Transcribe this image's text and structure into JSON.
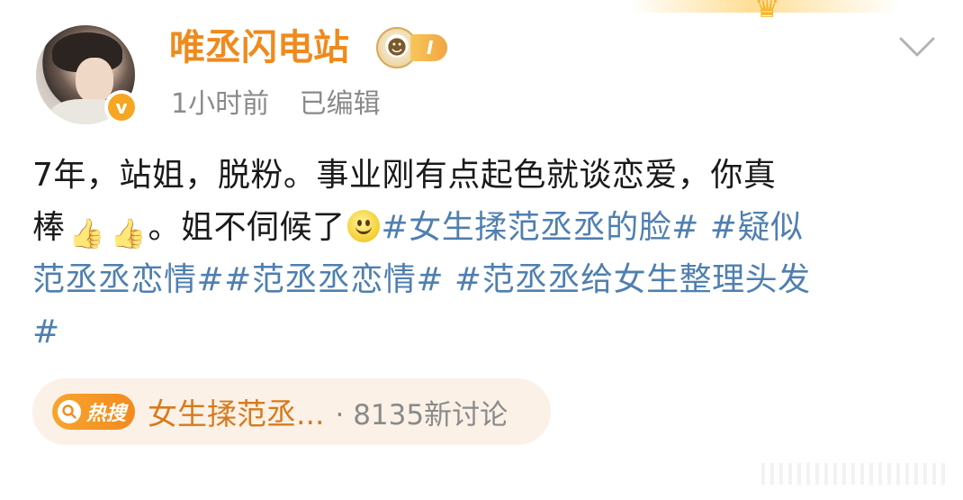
{
  "colors": {
    "username": "#f08a1c",
    "hashtag": "#4f7fb0",
    "meta": "#8a8a8a",
    "hot_pill_bg": "#fbf1e7",
    "hot_badge": "#f38a1e"
  },
  "post": {
    "username": "唯丞闪电站",
    "level_badge": "I",
    "time": "1小时前",
    "edited": "已编辑",
    "verified_icon": "v",
    "lines": [
      {
        "text": "7年，站姐，脱粉。事业刚有点起色就谈恋爱，你真"
      },
      {
        "before": "棒",
        "after": "。姐不伺候了",
        "hashtag": "#女生揉范丞丞的脸# #疑似"
      },
      {
        "hashtag": "范丞丞恋情##范丞丞恋情# #范丞丞给女生整理头发"
      },
      {
        "hashtag": "#"
      }
    ],
    "icons": [
      "thumbs-up-icon",
      "thumbs-up-icon",
      "smiley-icon"
    ]
  },
  "hot_search": {
    "badge_label": "热搜",
    "topic": "女生揉范丞...",
    "count": "· 8135新讨论"
  }
}
